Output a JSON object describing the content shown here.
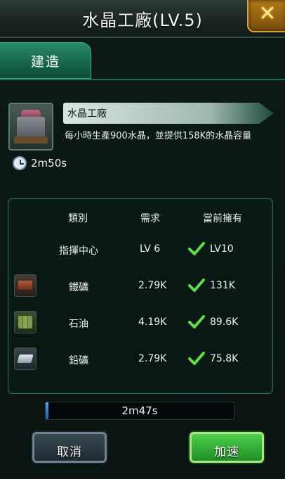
{
  "title": "水晶工廠(LV.5)",
  "close_symbol": "✕",
  "tabs": [
    {
      "label": "建造"
    }
  ],
  "building": {
    "icon": "crystal-factory-icon",
    "name": "水晶工廠",
    "description": "每小時生產900水晶，並提供158K的水晶容量",
    "build_time": "2m50s"
  },
  "requirements": {
    "headers": {
      "category": "類別",
      "required": "需求",
      "current": "當前擁有"
    },
    "rows": [
      {
        "name": "指揮中心",
        "icon": "",
        "required": "LV 6",
        "current": "LV10",
        "met": true
      },
      {
        "name": "鐵礦",
        "icon": "iron-ore-icon",
        "required": "2.79K",
        "current": "131K",
        "met": true
      },
      {
        "name": "石油",
        "icon": "oil-icon",
        "required": "4.19K",
        "current": "89.6K",
        "met": true
      },
      {
        "name": "鉛礦",
        "icon": "lead-ore-icon",
        "required": "2.79K",
        "current": "75.8K",
        "met": true
      }
    ]
  },
  "progress": {
    "label": "2m47s",
    "fraction": 0.01
  },
  "buttons": {
    "cancel": "取消",
    "speedup": "加速"
  },
  "colors": {
    "accent": "#1f8f6a",
    "confirm": "#2fae34",
    "check": "#5fe04a"
  }
}
